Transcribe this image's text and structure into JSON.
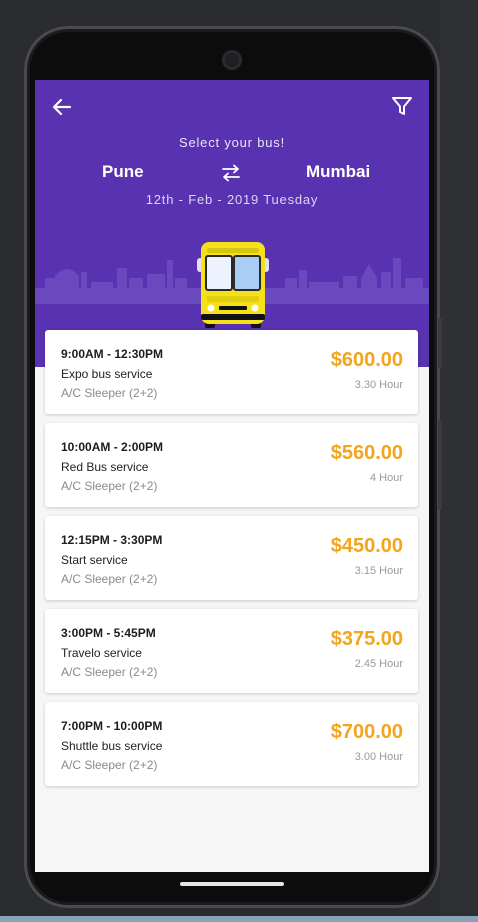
{
  "header": {
    "subtitle": "Select your bus!",
    "from_city": "Pune",
    "to_city": "Mumbai",
    "date": "12th - Feb - 2019  Tuesday"
  },
  "icons": {
    "back": "back-arrow-icon",
    "filter": "filter-icon",
    "swap": "swap-arrows-icon"
  },
  "colors": {
    "header_bg": "#5832b0",
    "price": "#f2a51d",
    "bus_yellow": "#f4e11a"
  },
  "buses": [
    {
      "time": "9:00AM - 12:30PM",
      "service": "Expo bus service",
      "seat": "A/C Sleeper (2+2)",
      "price": "$600.00",
      "duration": "3.30 Hour"
    },
    {
      "time": "10:00AM - 2:00PM",
      "service": "Red Bus service",
      "seat": "A/C Sleeper (2+2)",
      "price": "$560.00",
      "duration": "4 Hour"
    },
    {
      "time": "12:15PM - 3:30PM",
      "service": "Start service",
      "seat": "A/C Sleeper (2+2)",
      "price": "$450.00",
      "duration": "3.15 Hour"
    },
    {
      "time": "3:00PM - 5:45PM",
      "service": "Travelo service",
      "seat": "A/C Sleeper (2+2)",
      "price": "$375.00",
      "duration": "2.45 Hour"
    },
    {
      "time": "7:00PM - 10:00PM",
      "service": "Shuttle bus service",
      "seat": "A/C Sleeper (2+2)",
      "price": "$700.00",
      "duration": "3.00 Hour"
    }
  ]
}
